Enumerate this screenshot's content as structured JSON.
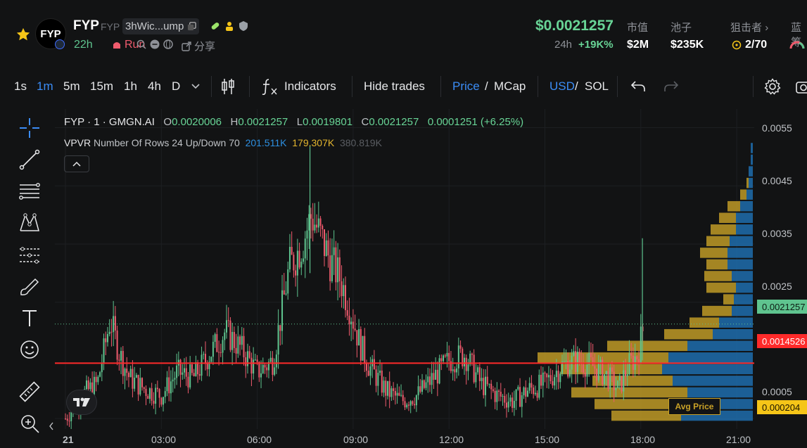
{
  "token": {
    "logo_text": "FYP",
    "name": "FYP",
    "symbol": "FYP",
    "address": "3hWic...ump",
    "age": "22h",
    "status": "Run",
    "share_label": "分享"
  },
  "stats": {
    "price": "$0.0021257",
    "change_label": "24h",
    "change_value": "+19K%",
    "mcap_label": "市值",
    "mcap_value": "$2M",
    "pool_label": "池子",
    "pool_value": "$235K",
    "sniper_label": "狙击者",
    "sniper_value": "2/70",
    "bluechip_label": "蓝筹"
  },
  "toolbar": {
    "intervals": [
      "1s",
      "1m",
      "5m",
      "15m",
      "1h",
      "4h",
      "D"
    ],
    "active_interval": "1m",
    "indicators": "Indicators",
    "hide_trades": "Hide trades",
    "price": "Price",
    "mcap": "MCap",
    "usd": "USD",
    "sol": "SOL",
    "slash": "/"
  },
  "legend": {
    "title": "FYP · 1 · GMGN.AI",
    "o_label": "O",
    "o_value": "0.0020006",
    "h_label": "H",
    "h_value": "0.0021257",
    "l_label": "L",
    "l_value": "0.0019801",
    "c_label": "C",
    "c_value": "0.0021257",
    "change": "0.0001251 (+6.25%)",
    "vpvr_label": "VPVR",
    "vpvr_params": "Number Of Rows 24 Up/Down 70",
    "vpvr_up": "201.511K",
    "vpvr_down": "179.307K",
    "vpvr_total": "380.819K"
  },
  "chart_data": {
    "type": "candlestick",
    "title": "FYP · 1 · GMGN.AI",
    "x_ticks": [
      "21",
      "03:00",
      "06:00",
      "09:00",
      "12:00",
      "15:00",
      "18:00",
      "21:00"
    ],
    "y_ticks": [
      "0.0055",
      "0.0045",
      "0.0035",
      "0.0025",
      "0.0005"
    ],
    "ylim": [
      0.0002,
      0.0057
    ],
    "current_price": "0.0021257",
    "line_price": "0.0014526",
    "avg_price": "0.000204",
    "avg_price_label": "Avg Price",
    "price_path": [
      [
        0,
        0.0005
      ],
      [
        0.5,
        0.0009
      ],
      [
        1,
        0.0011
      ],
      [
        1.4,
        0.0022
      ],
      [
        1.7,
        0.0016
      ],
      [
        2,
        0.0012
      ],
      [
        2.5,
        0.001
      ],
      [
        3,
        0.0009
      ],
      [
        3.5,
        0.0013
      ],
      [
        4,
        0.0012
      ],
      [
        4.5,
        0.0016
      ],
      [
        5,
        0.002
      ],
      [
        5.5,
        0.0017
      ],
      [
        6,
        0.0013
      ],
      [
        6.5,
        0.0015
      ],
      [
        7,
        0.0031
      ],
      [
        7.4,
        0.0035
      ],
      [
        7.7,
        0.004
      ],
      [
        8,
        0.0036
      ],
      [
        8.3,
        0.0032
      ],
      [
        8.6,
        0.0029
      ],
      [
        8.9,
        0.0024
      ],
      [
        9.2,
        0.0018
      ],
      [
        9.5,
        0.0014
      ],
      [
        10,
        0.001
      ],
      [
        10.5,
        0.0008
      ],
      [
        11,
        0.0009
      ],
      [
        11.5,
        0.0012
      ],
      [
        12,
        0.0015
      ],
      [
        12.5,
        0.0016
      ],
      [
        13,
        0.0011
      ],
      [
        13.5,
        0.0009
      ],
      [
        14,
        0.0008
      ],
      [
        14.5,
        0.001
      ],
      [
        15,
        0.0011
      ],
      [
        15.5,
        0.0014
      ],
      [
        16,
        0.0015
      ],
      [
        16.5,
        0.0014
      ],
      [
        17,
        0.0012
      ],
      [
        17.3,
        0.001
      ],
      [
        17.6,
        0.0014
      ],
      [
        17.9,
        0.0016
      ],
      [
        18.1,
        0.0021257
      ]
    ],
    "spikes": [
      [
        7.65,
        0.0052,
        0.003
      ],
      [
        18.05,
        0.0036,
        0.0015
      ]
    ],
    "vpvr_rows": [
      {
        "price": 0.00055,
        "up": 0.33,
        "down": 0.34
      },
      {
        "price": 0.00075,
        "up": 0.42,
        "down": 0.33
      },
      {
        "price": 0.00095,
        "up": 0.55,
        "down": 0.31
      },
      {
        "price": 0.00115,
        "up": 0.38,
        "down": 0.38
      },
      {
        "price": 0.00135,
        "up": 0.48,
        "down": 0.43
      },
      {
        "price": 0.00155,
        "up": 0.62,
        "down": 0.4
      },
      {
        "price": 0.00175,
        "up": 0.38,
        "down": 0.31
      },
      {
        "price": 0.00195,
        "up": 0.23,
        "down": 0.19
      },
      {
        "price": 0.00215,
        "up": 0.14,
        "down": 0.16
      },
      {
        "price": 0.00235,
        "up": 0.14,
        "down": 0.1
      },
      {
        "price": 0.00255,
        "up": 0.05,
        "down": 0.09
      },
      {
        "price": 0.00275,
        "up": 0.14,
        "down": 0.08
      },
      {
        "price": 0.00295,
        "up": 0.13,
        "down": 0.1
      },
      {
        "price": 0.00315,
        "up": 0.1,
        "down": 0.12
      },
      {
        "price": 0.00335,
        "up": 0.13,
        "down": 0.12
      },
      {
        "price": 0.00355,
        "up": 0.11,
        "down": 0.11
      },
      {
        "price": 0.00375,
        "up": 0.12,
        "down": 0.08
      },
      {
        "price": 0.00395,
        "up": 0.08,
        "down": 0.08
      },
      {
        "price": 0.00415,
        "up": 0.06,
        "down": 0.06
      },
      {
        "price": 0.00435,
        "up": 0.03,
        "down": 0.03
      },
      {
        "price": 0.00455,
        "up": 0.01,
        "down": 0.02
      },
      {
        "price": 0.00475,
        "up": 0.0,
        "down": 0.02
      },
      {
        "price": 0.00495,
        "up": 0.0,
        "down": 0.01
      },
      {
        "price": 0.00515,
        "up": 0.0,
        "down": 0.01
      }
    ]
  },
  "colors": {
    "up": "#5fc48f",
    "down": "#ef5b6d",
    "vpvr_up": "#c9a227",
    "vpvr_down": "#1f73b7",
    "price_line": "#ff2a2a",
    "accent": "#3b8cf5"
  }
}
